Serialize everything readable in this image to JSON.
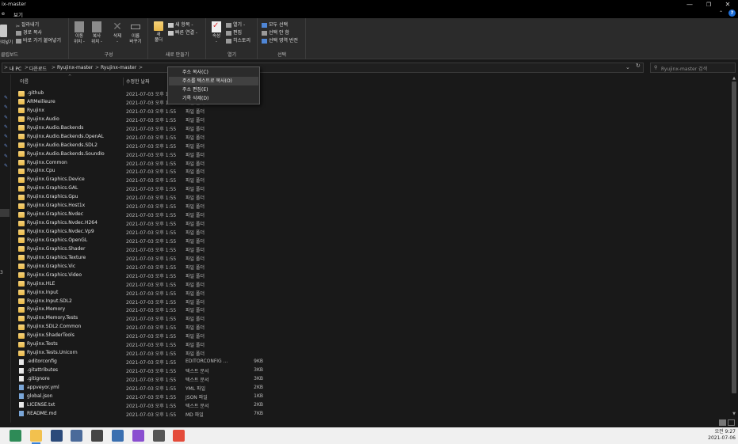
{
  "window": {
    "title": "ix-master",
    "minimize": "—",
    "maximize": "❐",
    "close": "✕"
  },
  "menubar": {
    "items": [
      {
        "label": "e"
      },
      {
        "label": "보기"
      }
    ],
    "expand_caret": "⌃",
    "help": "?"
  },
  "ribbon": {
    "clipboard": {
      "paste_label": "붙여넣기",
      "cut": "잘라내기",
      "copy_path": "경로 복사",
      "paste_shortcut": "바로 가기 붙여넣기",
      "group_label": "클립보드"
    },
    "organize": {
      "move_to": [
        "이동",
        "위치 -"
      ],
      "copy_to": [
        "복사",
        "위치 -"
      ],
      "delete": [
        "삭제",
        "-"
      ],
      "rename": [
        "이름",
        "바꾸기"
      ],
      "group_label": "구성"
    },
    "new": {
      "new_folder": [
        "새",
        "폴더"
      ],
      "new_item": "새 항목 -",
      "easy_access": "빠른 연결 -",
      "group_label": "새로 만들기"
    },
    "open": {
      "properties": [
        "속성",
        "-"
      ],
      "open": "열기 -",
      "edit": "편집",
      "history": "히스토리",
      "group_label": "열기"
    },
    "select": {
      "select_all": "모두 선택",
      "select_none": "선택 안 함",
      "invert": "선택 영역 반전",
      "group_label": "선택"
    }
  },
  "address": {
    "lead": ">",
    "crumbs": [
      "내 PC",
      "다운로드",
      "Ryujinx-master",
      "Ryujinx-master"
    ],
    "sep": ">",
    "dropdown": "⌄",
    "refresh": "↻",
    "search_placeholder": "Ryujinx-master 검색",
    "search_icon": "⚲"
  },
  "context_menu": {
    "items": [
      {
        "label": "주소 복사(C)",
        "highlighted": false
      },
      {
        "label": "주소를 텍스트로 복사(O)",
        "highlighted": true
      },
      {
        "label": "주소 편집(E)",
        "highlighted": false
      },
      {
        "label": "기록 삭제(D)",
        "highlighted": false
      }
    ]
  },
  "columns": {
    "name": "이름",
    "modified": "수정한 날짜",
    "sort_caret": "^"
  },
  "nav": {
    "pin": "✎",
    "number": "3"
  },
  "files": [
    {
      "name": ".github",
      "date": "2021-07-03 오후 1:55",
      "type": "파일 폴더",
      "size": "",
      "kind": "folder"
    },
    {
      "name": "ARMeilleure",
      "date": "2021-07-03 오후 1:55",
      "type": "파일 폴더",
      "size": "",
      "kind": "folder"
    },
    {
      "name": "Ryujinx",
      "date": "2021-07-03 오후 1:55",
      "type": "파일 폴더",
      "size": "",
      "kind": "folder"
    },
    {
      "name": "Ryujinx.Audio",
      "date": "2021-07-03 오후 1:55",
      "type": "파일 폴더",
      "size": "",
      "kind": "folder"
    },
    {
      "name": "Ryujinx.Audio.Backends",
      "date": "2021-07-03 오후 1:55",
      "type": "파일 폴더",
      "size": "",
      "kind": "folder"
    },
    {
      "name": "Ryujinx.Audio.Backends.OpenAL",
      "date": "2021-07-03 오후 1:55",
      "type": "파일 폴더",
      "size": "",
      "kind": "folder"
    },
    {
      "name": "Ryujinx.Audio.Backends.SDL2",
      "date": "2021-07-03 오후 1:55",
      "type": "파일 폴더",
      "size": "",
      "kind": "folder"
    },
    {
      "name": "Ryujinx.Audio.Backends.SoundIo",
      "date": "2021-07-03 오후 1:55",
      "type": "파일 폴더",
      "size": "",
      "kind": "folder"
    },
    {
      "name": "Ryujinx.Common",
      "date": "2021-07-03 오후 1:55",
      "type": "파일 폴더",
      "size": "",
      "kind": "folder"
    },
    {
      "name": "Ryujinx.Cpu",
      "date": "2021-07-03 오후 1:55",
      "type": "파일 폴더",
      "size": "",
      "kind": "folder"
    },
    {
      "name": "Ryujinx.Graphics.Device",
      "date": "2021-07-03 오후 1:55",
      "type": "파일 폴더",
      "size": "",
      "kind": "folder"
    },
    {
      "name": "Ryujinx.Graphics.GAL",
      "date": "2021-07-03 오후 1:55",
      "type": "파일 폴더",
      "size": "",
      "kind": "folder"
    },
    {
      "name": "Ryujinx.Graphics.Gpu",
      "date": "2021-07-03 오후 1:55",
      "type": "파일 폴더",
      "size": "",
      "kind": "folder"
    },
    {
      "name": "Ryujinx.Graphics.Host1x",
      "date": "2021-07-03 오후 1:55",
      "type": "파일 폴더",
      "size": "",
      "kind": "folder"
    },
    {
      "name": "Ryujinx.Graphics.Nvdec",
      "date": "2021-07-03 오후 1:55",
      "type": "파일 폴더",
      "size": "",
      "kind": "folder"
    },
    {
      "name": "Ryujinx.Graphics.Nvdec.H264",
      "date": "2021-07-03 오후 1:55",
      "type": "파일 폴더",
      "size": "",
      "kind": "folder"
    },
    {
      "name": "Ryujinx.Graphics.Nvdec.Vp9",
      "date": "2021-07-03 오후 1:55",
      "type": "파일 폴더",
      "size": "",
      "kind": "folder"
    },
    {
      "name": "Ryujinx.Graphics.OpenGL",
      "date": "2021-07-03 오후 1:55",
      "type": "파일 폴더",
      "size": "",
      "kind": "folder"
    },
    {
      "name": "Ryujinx.Graphics.Shader",
      "date": "2021-07-03 오후 1:55",
      "type": "파일 폴더",
      "size": "",
      "kind": "folder"
    },
    {
      "name": "Ryujinx.Graphics.Texture",
      "date": "2021-07-03 오후 1:55",
      "type": "파일 폴더",
      "size": "",
      "kind": "folder"
    },
    {
      "name": "Ryujinx.Graphics.Vic",
      "date": "2021-07-03 오후 1:55",
      "type": "파일 폴더",
      "size": "",
      "kind": "folder"
    },
    {
      "name": "Ryujinx.Graphics.Video",
      "date": "2021-07-03 오후 1:55",
      "type": "파일 폴더",
      "size": "",
      "kind": "folder"
    },
    {
      "name": "Ryujinx.HLE",
      "date": "2021-07-03 오후 1:55",
      "type": "파일 폴더",
      "size": "",
      "kind": "folder"
    },
    {
      "name": "Ryujinx.Input",
      "date": "2021-07-03 오후 1:55",
      "type": "파일 폴더",
      "size": "",
      "kind": "folder"
    },
    {
      "name": "Ryujinx.Input.SDL2",
      "date": "2021-07-03 오후 1:55",
      "type": "파일 폴더",
      "size": "",
      "kind": "folder"
    },
    {
      "name": "Ryujinx.Memory",
      "date": "2021-07-03 오후 1:55",
      "type": "파일 폴더",
      "size": "",
      "kind": "folder"
    },
    {
      "name": "Ryujinx.Memory.Tests",
      "date": "2021-07-03 오후 1:55",
      "type": "파일 폴더",
      "size": "",
      "kind": "folder"
    },
    {
      "name": "Ryujinx.SDL2.Common",
      "date": "2021-07-03 오후 1:55",
      "type": "파일 폴더",
      "size": "",
      "kind": "folder"
    },
    {
      "name": "Ryujinx.ShaderTools",
      "date": "2021-07-03 오후 1:55",
      "type": "파일 폴더",
      "size": "",
      "kind": "folder"
    },
    {
      "name": "Ryujinx.Tests",
      "date": "2021-07-03 오후 1:55",
      "type": "파일 폴더",
      "size": "",
      "kind": "folder"
    },
    {
      "name": "Ryujinx.Tests.Unicorn",
      "date": "2021-07-03 오후 1:55",
      "type": "파일 폴더",
      "size": "",
      "kind": "folder"
    },
    {
      "name": ".editorconfig",
      "date": "2021-07-03 오후 1:55",
      "type": "EDITORCONFIG ...",
      "size": "9KB",
      "kind": "file"
    },
    {
      "name": ".gitattributes",
      "date": "2021-07-03 오후 1:55",
      "type": "텍스트 문서",
      "size": "3KB",
      "kind": "file"
    },
    {
      "name": ".gitignore",
      "date": "2021-07-03 오후 1:55",
      "type": "텍스트 문서",
      "size": "3KB",
      "kind": "file"
    },
    {
      "name": "appveyor.yml",
      "date": "2021-07-03 오후 1:55",
      "type": "YML 파일",
      "size": "2KB",
      "kind": "file-blue"
    },
    {
      "name": "global.json",
      "date": "2021-07-03 오후 1:55",
      "type": "JSON 파일",
      "size": "1KB",
      "kind": "file-blue"
    },
    {
      "name": "LICENSE.txt",
      "date": "2021-07-03 오후 1:55",
      "type": "텍스트 문서",
      "size": "2KB",
      "kind": "file"
    },
    {
      "name": "README.md",
      "date": "2021-07-03 오후 1:55",
      "type": "MD 파일",
      "size": "7KB",
      "kind": "file-blue"
    }
  ],
  "scrollbar": {
    "up": "▲",
    "down": "▼"
  },
  "taskbar": {
    "apps": [
      {
        "name": "spreadsheet-icon",
        "color": "#2e8b57",
        "active": false
      },
      {
        "name": "file-explorer-icon",
        "color": "#f2c14e",
        "active": true
      },
      {
        "name": "game-icon",
        "color": "#2b4a7a",
        "active": false
      },
      {
        "name": "app-icon",
        "color": "#4a6a9a",
        "active": false
      },
      {
        "name": "tool-icon",
        "color": "#444",
        "active": false
      },
      {
        "name": "calculator-icon",
        "color": "#3a6fb0",
        "active": false
      },
      {
        "name": "controller-icon",
        "color": "#8a4fd0",
        "active": false
      },
      {
        "name": "settings-icon",
        "color": "#555",
        "active": false
      },
      {
        "name": "chrome-icon",
        "color": "#e44b3a",
        "active": false
      }
    ],
    "time": "오전 9:27",
    "date": "2021-07-06"
  }
}
